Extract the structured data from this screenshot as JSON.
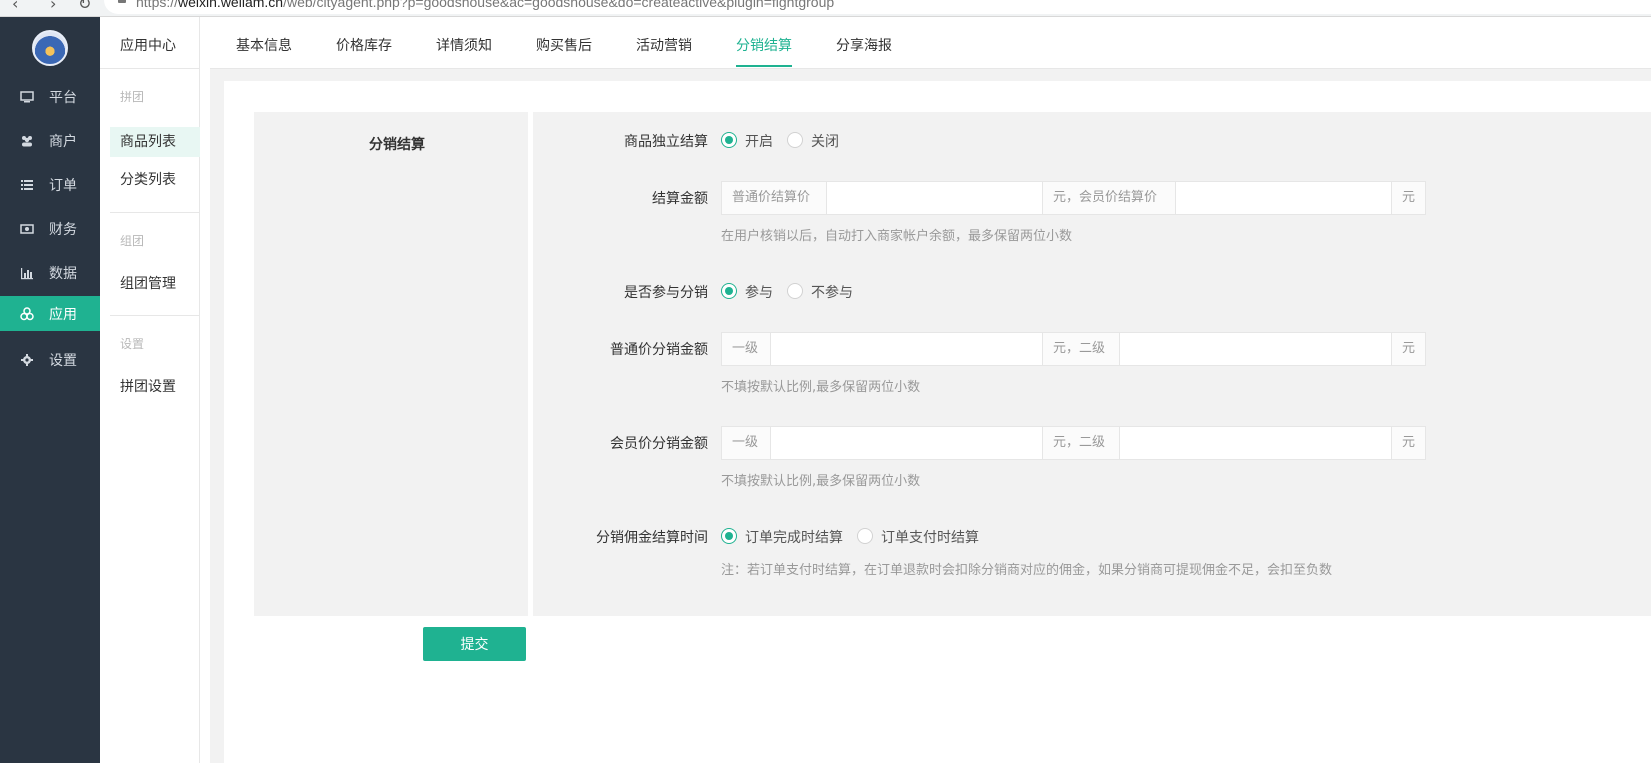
{
  "browser": {
    "url_dim_prefix": "https://",
    "url_domain": "weixin.weliam.cn",
    "url_path": "/web/cityagent.php?p=goodshouse&ac=goodshouse&do=createactive&plugin=fightgroup"
  },
  "sidebar": {
    "items": [
      {
        "label": "平台",
        "icon": "monitor-icon"
      },
      {
        "label": "商户",
        "icon": "users-icon"
      },
      {
        "label": "订单",
        "icon": "list-icon"
      },
      {
        "label": "财务",
        "icon": "money-icon"
      },
      {
        "label": "数据",
        "icon": "bar-chart-icon"
      },
      {
        "label": "应用",
        "icon": "cubes-icon"
      },
      {
        "label": "设置",
        "icon": "gear-icon"
      }
    ],
    "active_index": 5
  },
  "subnav": {
    "title": "应用中心",
    "group1": "拼团",
    "item1": "商品列表",
    "item2": "分类列表",
    "group2": "组团",
    "item3": "组团管理",
    "group3": "设置",
    "item4": "拼团设置"
  },
  "tabs": [
    "基本信息",
    "价格库存",
    "详情须知",
    "购买售后",
    "活动营销",
    "分销结算",
    "分享海报"
  ],
  "active_tab": "分销结算",
  "section_title": "分销结算",
  "form": {
    "independent_settle": {
      "label": "商品独立结算",
      "opt_on": "开启",
      "opt_off": "关闭",
      "value": "开启"
    },
    "settle_amount": {
      "label": "结算金额",
      "addon1": "普通价结算价",
      "addon2": "元，会员价结算价",
      "addon3": "元",
      "help": "在用户核销以后，自动打入商家帐户余额，最多保留两位小数"
    },
    "join_distribution": {
      "label": "是否参与分销",
      "opt_yes": "参与",
      "opt_no": "不参与",
      "value": "参与"
    },
    "normal_commission": {
      "label": "普通价分销金额",
      "addon1": "一级",
      "addon2": "元，二级",
      "addon3": "元",
      "help": "不填按默认比例,最多保留两位小数"
    },
    "member_commission": {
      "label": "会员价分销金额",
      "addon1": "一级",
      "addon2": "元，二级",
      "addon3": "元",
      "help": "不填按默认比例,最多保留两位小数"
    },
    "commission_time": {
      "label": "分销佣金结算时间",
      "opt_complete": "订单完成时结算",
      "opt_pay": "订单支付时结算",
      "value": "订单完成时结算",
      "help": "注：若订单支付时结算，在订单退款时会扣除分销商对应的佣金，如果分销商可提现佣金不足，会扣至负数"
    }
  },
  "submit_label": "提交",
  "colors": {
    "accent": "#1fb291",
    "sidebar_bg": "#2a3542"
  }
}
